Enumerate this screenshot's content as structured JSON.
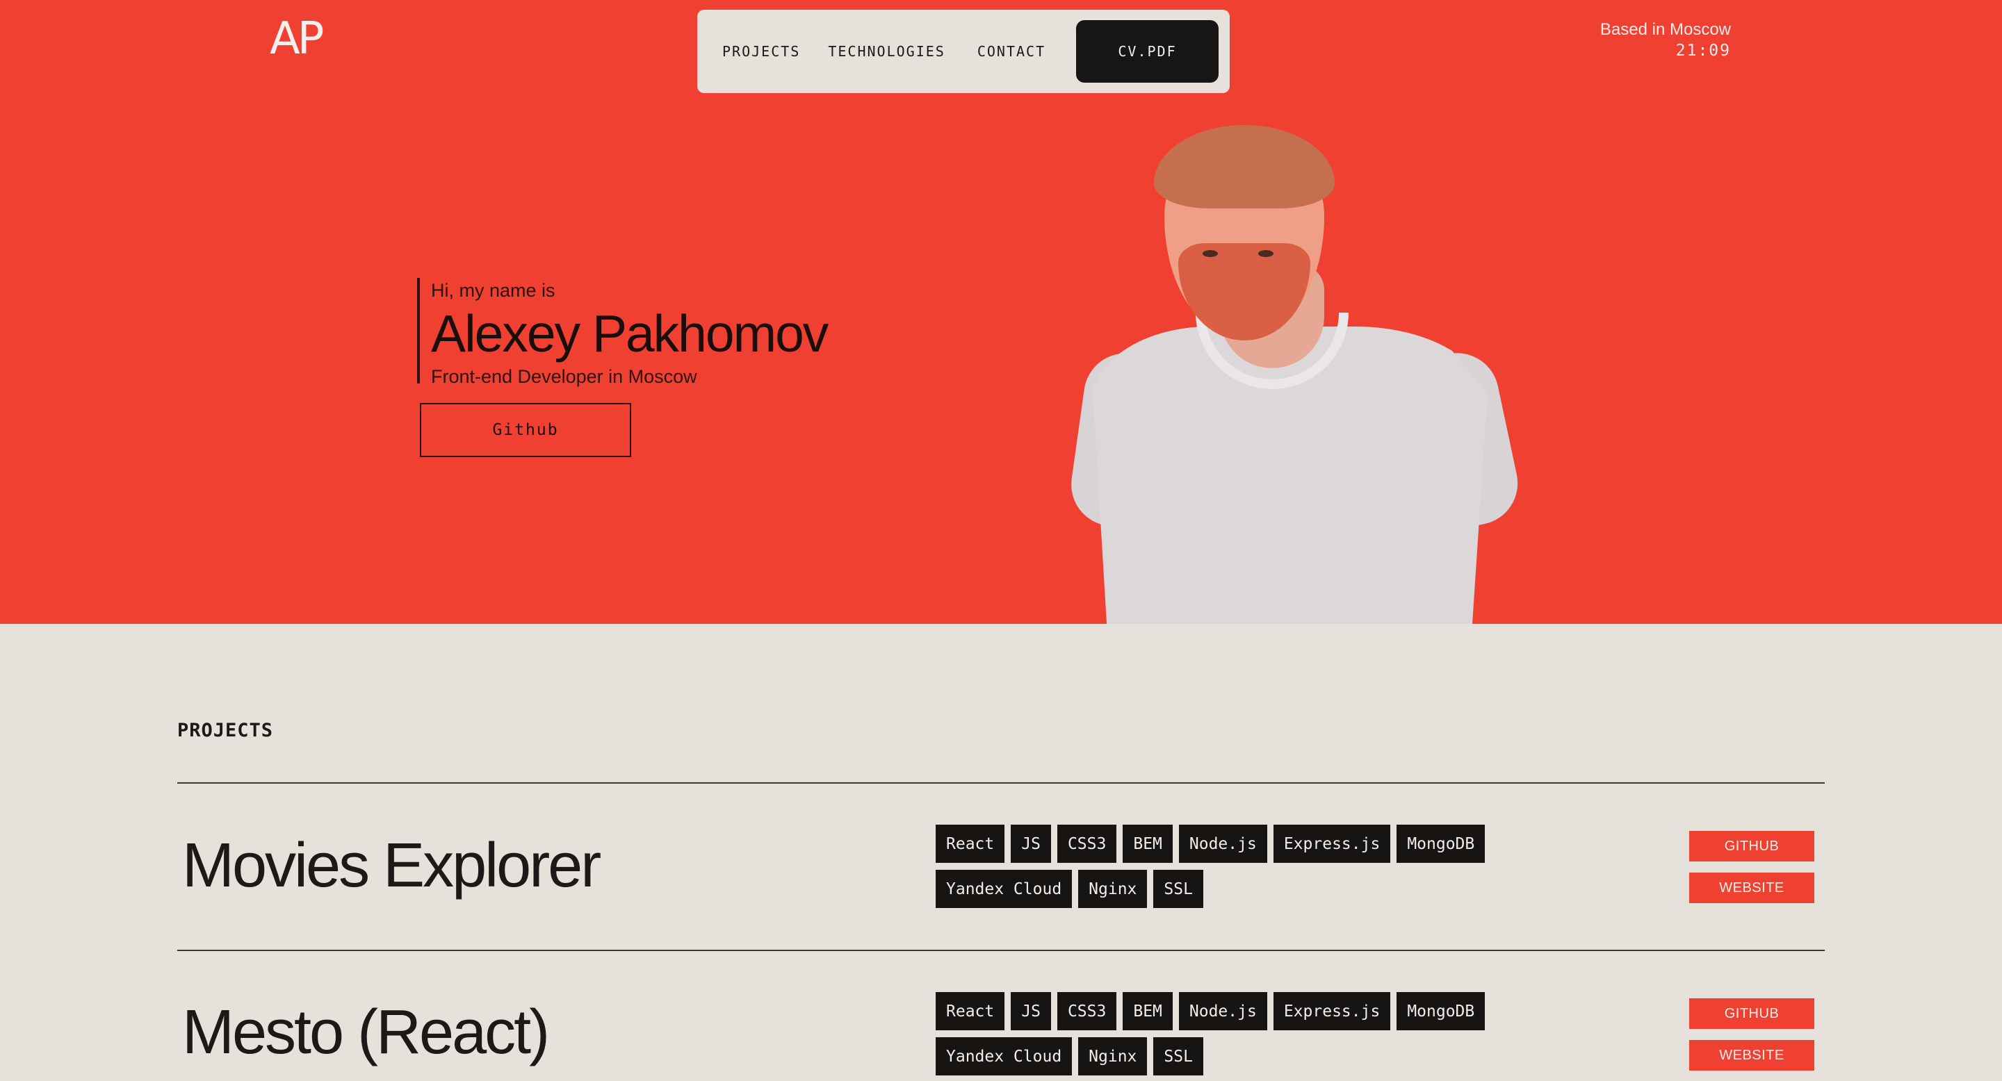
{
  "header": {
    "logo": "AP",
    "nav": {
      "projects": "PROJECTS",
      "technologies": "TECHNOLOGIES",
      "contact": "CONTACT",
      "cv": "CV.PDF"
    },
    "location": "Based in Moscow",
    "time": "21:09"
  },
  "hero": {
    "greeting": "Hi, my name is",
    "name": "Alexey Pakhomov",
    "role": "Front-end Developer in Moscow",
    "github_button": "Github",
    "photo_icon": "portrait-photo"
  },
  "projects": {
    "title": "PROJECTS",
    "items": [
      {
        "name": "Movies Explorer",
        "tags": [
          "React",
          "JS",
          "CSS3",
          "BEM",
          "Node.js",
          "Express.js",
          "MongoDB",
          "Yandex Cloud",
          "Nginx",
          "SSL"
        ],
        "github": "GITHUB",
        "website": "WEBSITE"
      },
      {
        "name": "Mesto (React)",
        "tags": [
          "React",
          "JS",
          "CSS3",
          "BEM",
          "Node.js",
          "Express.js",
          "MongoDB",
          "Yandex Cloud",
          "Nginx",
          "SSL"
        ],
        "github": "GITHUB",
        "website": "WEBSITE"
      }
    ]
  },
  "colors": {
    "accent": "#ef4032",
    "background": "#e6e2db",
    "dark": "#161514"
  }
}
